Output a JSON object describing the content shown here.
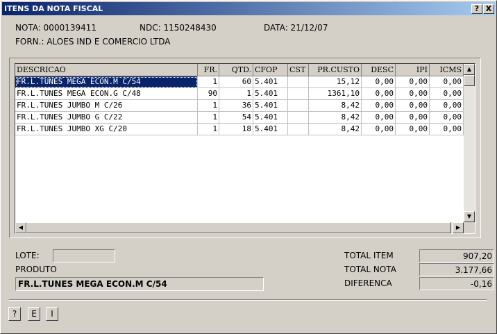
{
  "window": {
    "title": "ITENS DA NOTA FISCAL",
    "help_label": "?",
    "close_label": "X"
  },
  "header": {
    "nota": "NOTA: 0000139411",
    "ndc": "NDC: 1150248430",
    "data": "DATA: 21/12/07",
    "fornecedor": "FORN.: ALOES IND E COMERCIO LTDA"
  },
  "grid": {
    "columns": [
      "DESCRICAO",
      "FR.",
      "QTD.",
      "CFOP",
      "CST",
      "PR.CUSTO",
      "DESC",
      "IPI",
      "ICMS"
    ],
    "rows": [
      [
        "FR.L.TUNES MEGA ECON.M C/54",
        "1",
        "60",
        "5.401",
        "",
        "15,12",
        "0,00",
        "0,00",
        "0,00"
      ],
      [
        "FR.L.TUNES MEGA ECON.G C/48",
        "90",
        "1",
        "5.401",
        "",
        "1361,10",
        "0,00",
        "0,00",
        "0,00"
      ],
      [
        "FR.L.TUNES JUMBO M C/26",
        "1",
        "36",
        "5.401",
        "",
        "8,42",
        "0,00",
        "0,00",
        "0,00"
      ],
      [
        "FR.L.TUNES JUMBO G C/22",
        "1",
        "54",
        "5.401",
        "",
        "8,42",
        "0,00",
        "0,00",
        "0,00"
      ],
      [
        "FR.L.TUNES JUMBO XG C/20",
        "1",
        "18",
        "5.401",
        "",
        "8,42",
        "0,00",
        "0,00",
        "0,00"
      ]
    ],
    "selected_row": 0,
    "scroll_up": "▲",
    "scroll_down": "▼",
    "scroll_left": "◀",
    "scroll_right": "▶"
  },
  "footer": {
    "lote_label": "LOTE:",
    "lote_value": "",
    "produto_label": "PRODUTO",
    "produto_value": "FR.L.TUNES MEGA ECON.M C/54",
    "total_item_label": "TOTAL ITEM",
    "total_item_value": "907,20",
    "total_nota_label": "TOTAL NOTA",
    "total_nota_value": "3.177,66",
    "diferenca_label": "DIFERENCA",
    "diferenca_value": "-0,16"
  },
  "buttons": {
    "help": "?",
    "e": "E",
    "i": "I"
  }
}
